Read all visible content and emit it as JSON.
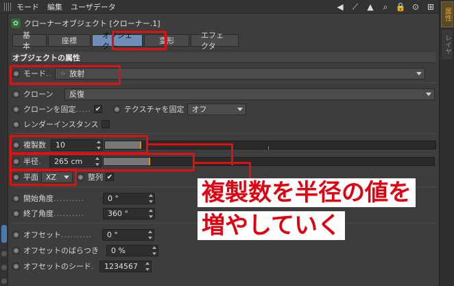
{
  "menu": [
    "モード",
    "編集",
    "ユーザデータ"
  ],
  "right_tabs": [
    "属性",
    "レイヤ"
  ],
  "object_title": "クローナーオブジェクト [クローナー.1]",
  "tabs": [
    "基本",
    "座標",
    "オブジェクト",
    "変形",
    "エフェクタ"
  ],
  "active_tab": "オブジェクト",
  "section_title": "オブジェクトの属性",
  "mode": {
    "label": "モード",
    "dots": "..",
    "value": "放射"
  },
  "clone": {
    "label": "クローン",
    "value": "反復"
  },
  "fix_clone": {
    "label": "クローンを固定",
    "dots": ".....",
    "checked": "✔"
  },
  "fix_texture": {
    "label": "テクスチャを固定",
    "value": "オフ"
  },
  "render_instance": {
    "label": "レンダーインスタンス"
  },
  "count": {
    "label": "複製数",
    "value": "10",
    "level": 0.42
  },
  "radius": {
    "label": "半径",
    "dots": ".",
    "value": "265 cm",
    "level": 0.55
  },
  "plane": {
    "label": "平面",
    "value": "XZ"
  },
  "align": {
    "label": "整列",
    "checked": "✔"
  },
  "start_angle": {
    "label": "開始角度",
    "dots": "..........",
    "value": "0 °"
  },
  "end_angle": {
    "label": "終了角度",
    "dots": "..........",
    "value": "360 °"
  },
  "offset": {
    "label": "オフセット",
    "dots": "..........",
    "value": "0 °"
  },
  "offset_var": {
    "label": "オフセットのばらつき",
    "value": "0 %"
  },
  "offset_seed": {
    "label": "オフセットのシード",
    "dots": ".",
    "value": "1234567"
  },
  "annotation": {
    "line1": "複製数を半径の値を",
    "line2": "増やしていく"
  },
  "colors": {
    "highlight": "#e01010",
    "accent": "#f08a00",
    "active_tab": "#6f8fb8"
  }
}
